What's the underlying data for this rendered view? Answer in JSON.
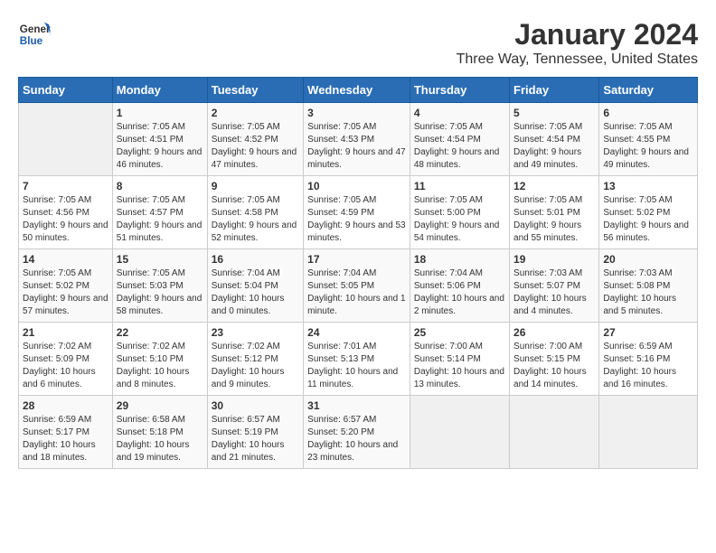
{
  "header": {
    "logo_line1": "General",
    "logo_line2": "Blue",
    "title": "January 2024",
    "subtitle": "Three Way, Tennessee, United States"
  },
  "days_of_week": [
    "Sunday",
    "Monday",
    "Tuesday",
    "Wednesday",
    "Thursday",
    "Friday",
    "Saturday"
  ],
  "weeks": [
    [
      {
        "day": "",
        "sunrise": "",
        "sunset": "",
        "daylight": "",
        "empty": true
      },
      {
        "day": "1",
        "sunrise": "Sunrise: 7:05 AM",
        "sunset": "Sunset: 4:51 PM",
        "daylight": "Daylight: 9 hours and 46 minutes."
      },
      {
        "day": "2",
        "sunrise": "Sunrise: 7:05 AM",
        "sunset": "Sunset: 4:52 PM",
        "daylight": "Daylight: 9 hours and 47 minutes."
      },
      {
        "day": "3",
        "sunrise": "Sunrise: 7:05 AM",
        "sunset": "Sunset: 4:53 PM",
        "daylight": "Daylight: 9 hours and 47 minutes."
      },
      {
        "day": "4",
        "sunrise": "Sunrise: 7:05 AM",
        "sunset": "Sunset: 4:54 PM",
        "daylight": "Daylight: 9 hours and 48 minutes."
      },
      {
        "day": "5",
        "sunrise": "Sunrise: 7:05 AM",
        "sunset": "Sunset: 4:54 PM",
        "daylight": "Daylight: 9 hours and 49 minutes."
      },
      {
        "day": "6",
        "sunrise": "Sunrise: 7:05 AM",
        "sunset": "Sunset: 4:55 PM",
        "daylight": "Daylight: 9 hours and 49 minutes."
      }
    ],
    [
      {
        "day": "7",
        "sunrise": "Sunrise: 7:05 AM",
        "sunset": "Sunset: 4:56 PM",
        "daylight": "Daylight: 9 hours and 50 minutes."
      },
      {
        "day": "8",
        "sunrise": "Sunrise: 7:05 AM",
        "sunset": "Sunset: 4:57 PM",
        "daylight": "Daylight: 9 hours and 51 minutes."
      },
      {
        "day": "9",
        "sunrise": "Sunrise: 7:05 AM",
        "sunset": "Sunset: 4:58 PM",
        "daylight": "Daylight: 9 hours and 52 minutes."
      },
      {
        "day": "10",
        "sunrise": "Sunrise: 7:05 AM",
        "sunset": "Sunset: 4:59 PM",
        "daylight": "Daylight: 9 hours and 53 minutes."
      },
      {
        "day": "11",
        "sunrise": "Sunrise: 7:05 AM",
        "sunset": "Sunset: 5:00 PM",
        "daylight": "Daylight: 9 hours and 54 minutes."
      },
      {
        "day": "12",
        "sunrise": "Sunrise: 7:05 AM",
        "sunset": "Sunset: 5:01 PM",
        "daylight": "Daylight: 9 hours and 55 minutes."
      },
      {
        "day": "13",
        "sunrise": "Sunrise: 7:05 AM",
        "sunset": "Sunset: 5:02 PM",
        "daylight": "Daylight: 9 hours and 56 minutes."
      }
    ],
    [
      {
        "day": "14",
        "sunrise": "Sunrise: 7:05 AM",
        "sunset": "Sunset: 5:02 PM",
        "daylight": "Daylight: 9 hours and 57 minutes."
      },
      {
        "day": "15",
        "sunrise": "Sunrise: 7:05 AM",
        "sunset": "Sunset: 5:03 PM",
        "daylight": "Daylight: 9 hours and 58 minutes."
      },
      {
        "day": "16",
        "sunrise": "Sunrise: 7:04 AM",
        "sunset": "Sunset: 5:04 PM",
        "daylight": "Daylight: 10 hours and 0 minutes."
      },
      {
        "day": "17",
        "sunrise": "Sunrise: 7:04 AM",
        "sunset": "Sunset: 5:05 PM",
        "daylight": "Daylight: 10 hours and 1 minute."
      },
      {
        "day": "18",
        "sunrise": "Sunrise: 7:04 AM",
        "sunset": "Sunset: 5:06 PM",
        "daylight": "Daylight: 10 hours and 2 minutes."
      },
      {
        "day": "19",
        "sunrise": "Sunrise: 7:03 AM",
        "sunset": "Sunset: 5:07 PM",
        "daylight": "Daylight: 10 hours and 4 minutes."
      },
      {
        "day": "20",
        "sunrise": "Sunrise: 7:03 AM",
        "sunset": "Sunset: 5:08 PM",
        "daylight": "Daylight: 10 hours and 5 minutes."
      }
    ],
    [
      {
        "day": "21",
        "sunrise": "Sunrise: 7:02 AM",
        "sunset": "Sunset: 5:09 PM",
        "daylight": "Daylight: 10 hours and 6 minutes."
      },
      {
        "day": "22",
        "sunrise": "Sunrise: 7:02 AM",
        "sunset": "Sunset: 5:10 PM",
        "daylight": "Daylight: 10 hours and 8 minutes."
      },
      {
        "day": "23",
        "sunrise": "Sunrise: 7:02 AM",
        "sunset": "Sunset: 5:12 PM",
        "daylight": "Daylight: 10 hours and 9 minutes."
      },
      {
        "day": "24",
        "sunrise": "Sunrise: 7:01 AM",
        "sunset": "Sunset: 5:13 PM",
        "daylight": "Daylight: 10 hours and 11 minutes."
      },
      {
        "day": "25",
        "sunrise": "Sunrise: 7:00 AM",
        "sunset": "Sunset: 5:14 PM",
        "daylight": "Daylight: 10 hours and 13 minutes."
      },
      {
        "day": "26",
        "sunrise": "Sunrise: 7:00 AM",
        "sunset": "Sunset: 5:15 PM",
        "daylight": "Daylight: 10 hours and 14 minutes."
      },
      {
        "day": "27",
        "sunrise": "Sunrise: 6:59 AM",
        "sunset": "Sunset: 5:16 PM",
        "daylight": "Daylight: 10 hours and 16 minutes."
      }
    ],
    [
      {
        "day": "28",
        "sunrise": "Sunrise: 6:59 AM",
        "sunset": "Sunset: 5:17 PM",
        "daylight": "Daylight: 10 hours and 18 minutes."
      },
      {
        "day": "29",
        "sunrise": "Sunrise: 6:58 AM",
        "sunset": "Sunset: 5:18 PM",
        "daylight": "Daylight: 10 hours and 19 minutes."
      },
      {
        "day": "30",
        "sunrise": "Sunrise: 6:57 AM",
        "sunset": "Sunset: 5:19 PM",
        "daylight": "Daylight: 10 hours and 21 minutes."
      },
      {
        "day": "31",
        "sunrise": "Sunrise: 6:57 AM",
        "sunset": "Sunset: 5:20 PM",
        "daylight": "Daylight: 10 hours and 23 minutes."
      },
      {
        "day": "",
        "sunrise": "",
        "sunset": "",
        "daylight": "",
        "empty": true
      },
      {
        "day": "",
        "sunrise": "",
        "sunset": "",
        "daylight": "",
        "empty": true
      },
      {
        "day": "",
        "sunrise": "",
        "sunset": "",
        "daylight": "",
        "empty": true
      }
    ]
  ]
}
